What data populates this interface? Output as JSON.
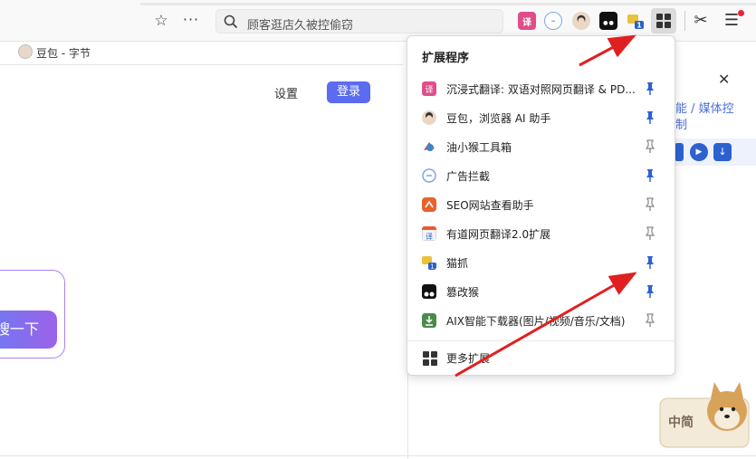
{
  "toolbar": {
    "search_query": "顾客逛店久被控偷窃"
  },
  "tab": {
    "title": "豆包 - 字节"
  },
  "page": {
    "settings_label": "设置",
    "login_label": "登录",
    "search_button_label": "搜一下"
  },
  "side_panel": {
    "close": "✕",
    "text": "能 / 媒体控制"
  },
  "extensions_popup": {
    "title": "扩展程序",
    "items": [
      {
        "label": "沉浸式翻译: 双语对照网页翻译 & PD...",
        "pinned": true,
        "icon": "immersive-translate-icon"
      },
      {
        "label": "豆包，浏览器 AI 助手",
        "pinned": true,
        "icon": "doubao-icon"
      },
      {
        "label": "油小猴工具箱",
        "pinned": false,
        "icon": "youxiaohou-icon"
      },
      {
        "label": "广告拦截",
        "pinned": true,
        "icon": "adblock-icon"
      },
      {
        "label": "SEO网站查看助手",
        "pinned": false,
        "icon": "seo-icon"
      },
      {
        "label": "有道网页翻译2.0扩展",
        "pinned": false,
        "icon": "youdao-icon"
      },
      {
        "label": "猫抓",
        "pinned": true,
        "icon": "maozhua-icon"
      },
      {
        "label": "篡改猴",
        "pinned": true,
        "icon": "tampermonkey-icon"
      },
      {
        "label": "AIX智能下载器(图片/视频/音乐/文档)",
        "pinned": false,
        "icon": "aix-downloader-icon"
      }
    ],
    "more_label": "更多扩展"
  },
  "watermark": {
    "label": "中简"
  },
  "colors": {
    "accent": "#5b6cf0",
    "pin_active": "#2c62d0",
    "pin_inactive": "#888888",
    "arrow": "#e02020"
  }
}
